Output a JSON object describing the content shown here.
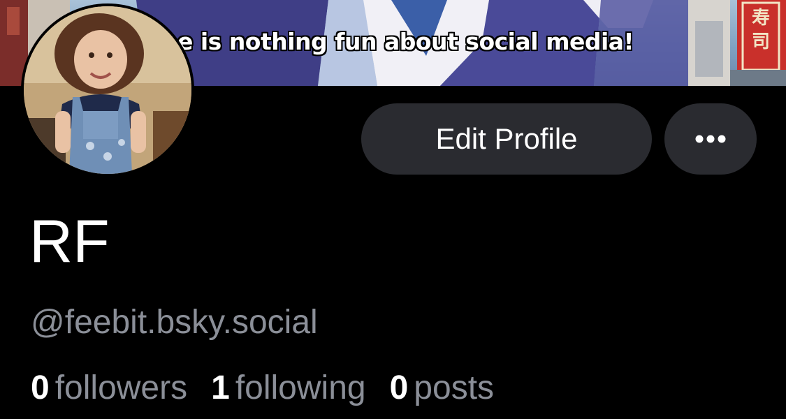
{
  "banner": {
    "caption": "e is nothing fun about social media!",
    "sign_text": "寿司"
  },
  "profile": {
    "avatar_alt": "profile photo",
    "display_name": "RF",
    "handle": "@feebit.bsky.social"
  },
  "actions": {
    "edit_profile_label": "Edit Profile",
    "more_icon": "more-horizontal-icon"
  },
  "stats": [
    {
      "count": "0",
      "label": "followers"
    },
    {
      "count": "1",
      "label": "following"
    },
    {
      "count": "0",
      "label": "posts"
    }
  ],
  "colors": {
    "background": "#000000",
    "button_bg": "#2a2b30",
    "text_primary": "#ffffff",
    "text_secondary": "#8b8f98"
  }
}
